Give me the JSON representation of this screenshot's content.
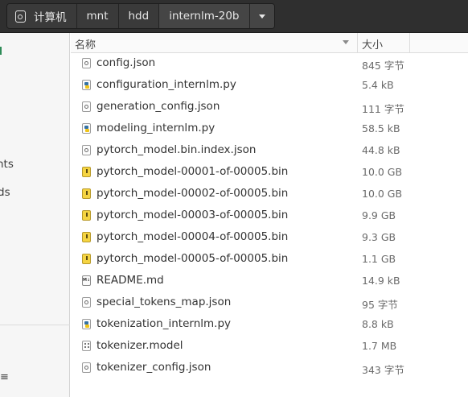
{
  "breadcrumb": {
    "items": [
      {
        "label": "计算机",
        "icon": "drive-icon"
      },
      {
        "label": "mnt"
      },
      {
        "label": "hdd"
      },
      {
        "label": "internlm-20b"
      }
    ]
  },
  "sidebar": {
    "partial_labels": [
      "nts",
      "ds"
    ],
    "bottom_glyph": "≡"
  },
  "columns": {
    "name": "名称",
    "size": "大小"
  },
  "files": [
    {
      "name": "config.json",
      "size": "845 字节",
      "icon": "text-file-icon"
    },
    {
      "name": "configuration_internlm.py",
      "size": "5.4 kB",
      "icon": "python-file-icon"
    },
    {
      "name": "generation_config.json",
      "size": "111 字节",
      "icon": "text-file-icon"
    },
    {
      "name": "modeling_internlm.py",
      "size": "58.5 kB",
      "icon": "python-file-icon"
    },
    {
      "name": "pytorch_model.bin.index.json",
      "size": "44.8 kB",
      "icon": "text-file-icon"
    },
    {
      "name": "pytorch_model-00001-of-00005.bin",
      "size": "10.0 GB",
      "icon": "binary-file-icon"
    },
    {
      "name": "pytorch_model-00002-of-00005.bin",
      "size": "10.0 GB",
      "icon": "binary-file-icon"
    },
    {
      "name": "pytorch_model-00003-of-00005.bin",
      "size": "9.9 GB",
      "icon": "binary-file-icon"
    },
    {
      "name": "pytorch_model-00004-of-00005.bin",
      "size": "9.3 GB",
      "icon": "binary-file-icon"
    },
    {
      "name": "pytorch_model-00005-of-00005.bin",
      "size": "1.1 GB",
      "icon": "binary-file-icon"
    },
    {
      "name": "README.md",
      "size": "14.9 kB",
      "icon": "markdown-file-icon"
    },
    {
      "name": "special_tokens_map.json",
      "size": "95 字节",
      "icon": "text-file-icon"
    },
    {
      "name": "tokenization_internlm.py",
      "size": "8.8 kB",
      "icon": "python-file-icon"
    },
    {
      "name": "tokenizer.model",
      "size": "1.7 MB",
      "icon": "model-file-icon"
    },
    {
      "name": "tokenizer_config.json",
      "size": "343 字节",
      "icon": "text-file-icon"
    }
  ],
  "colors": {
    "header_bg": "#2f2f2f",
    "crumb_bg": "#3a3a3a",
    "crumb_active_bg": "#454545",
    "sidebar_bg": "#f6f6f6",
    "sidebar_mark": "#2e8b57",
    "binary_icon": "#f5d442"
  }
}
